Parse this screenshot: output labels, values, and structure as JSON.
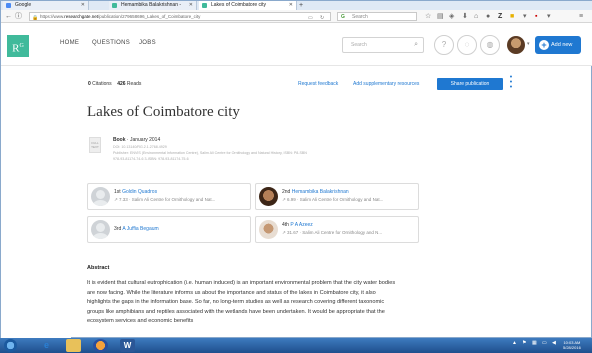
{
  "browser": {
    "tabs": [
      {
        "label": "Google",
        "active": false
      },
      {
        "label": "Hemambika Balakrishnan - ",
        "active": false
      },
      {
        "label": "Lakes of Coimbatore city",
        "active": true
      }
    ],
    "new_tab": "+",
    "url_prefix": "https://www.",
    "url_domain": "researchgate.net",
    "url_path": "/publication/279658696_Lakes_of_Coimbatore_city",
    "search_placeholder": "Search"
  },
  "rg": {
    "logo": "R",
    "logo_sup": "G",
    "nav": [
      "HOME",
      "QUESTIONS",
      "JOBS"
    ],
    "search_placeholder": "Search",
    "add_new": "Add new"
  },
  "publication": {
    "citations_count": "0",
    "citations_label": "Citations",
    "reads_count": "426",
    "reads_label": "Reads",
    "request_feedback": "Request feedback",
    "add_supplementary": "Add supplementary resources",
    "share": "Share publication",
    "title": "Lakes of Coimbatore city",
    "thumb_text": "FULL TEXT",
    "type": "Book",
    "date": " · January 2014",
    "doi": "DOI: 10.13140/RG.2.1.2768.4929",
    "publisher": "Publisher: ENVIS (Environmental Information Centre), Salim Ali Centre for Ornithology and Natural History, ISBN: P8-SBN",
    "isbn": "978-93-81174-74-6 3-ISBN: 978-93-81174-75-6"
  },
  "authors": [
    {
      "order": "1st",
      "name": "Goldin Quadros",
      "score": "↗ 7.33",
      "inst": " · Salim Ali Centre for Ornithology and Nat..."
    },
    {
      "order": "2nd",
      "name": "Hemambika Balakrishnan",
      "score": "↗ 6.99",
      "inst": " · Salim Ali Centre for Ornithology and Nat..."
    },
    {
      "order": "3rd",
      "name": "A Juffia Begaum",
      "score": "",
      "inst": ""
    },
    {
      "order": "4th",
      "name": "P A Azeez",
      "score": "↗ 31.67",
      "inst": " · Salim Ali Centre for Ornithology and N..."
    }
  ],
  "abstract": {
    "heading": "Abstract",
    "text": "It is evident that cultural eutrophication (i.e. human induced) is an important environmental problem that the city water bodies are now facing. While the literature informs us about the importance and status of the lakes in Coimbatore city, it also highlights the gaps in the information base. So far, no long-term studies as well as research covering different taxonomic groups like amphibians and reptiles associated with the wetlands have been undertaken. It would be appropriate that the ecosystem services and economic benefits"
  },
  "taskbar": {
    "time": "10:03 AM",
    "date": "5/28/2016"
  }
}
